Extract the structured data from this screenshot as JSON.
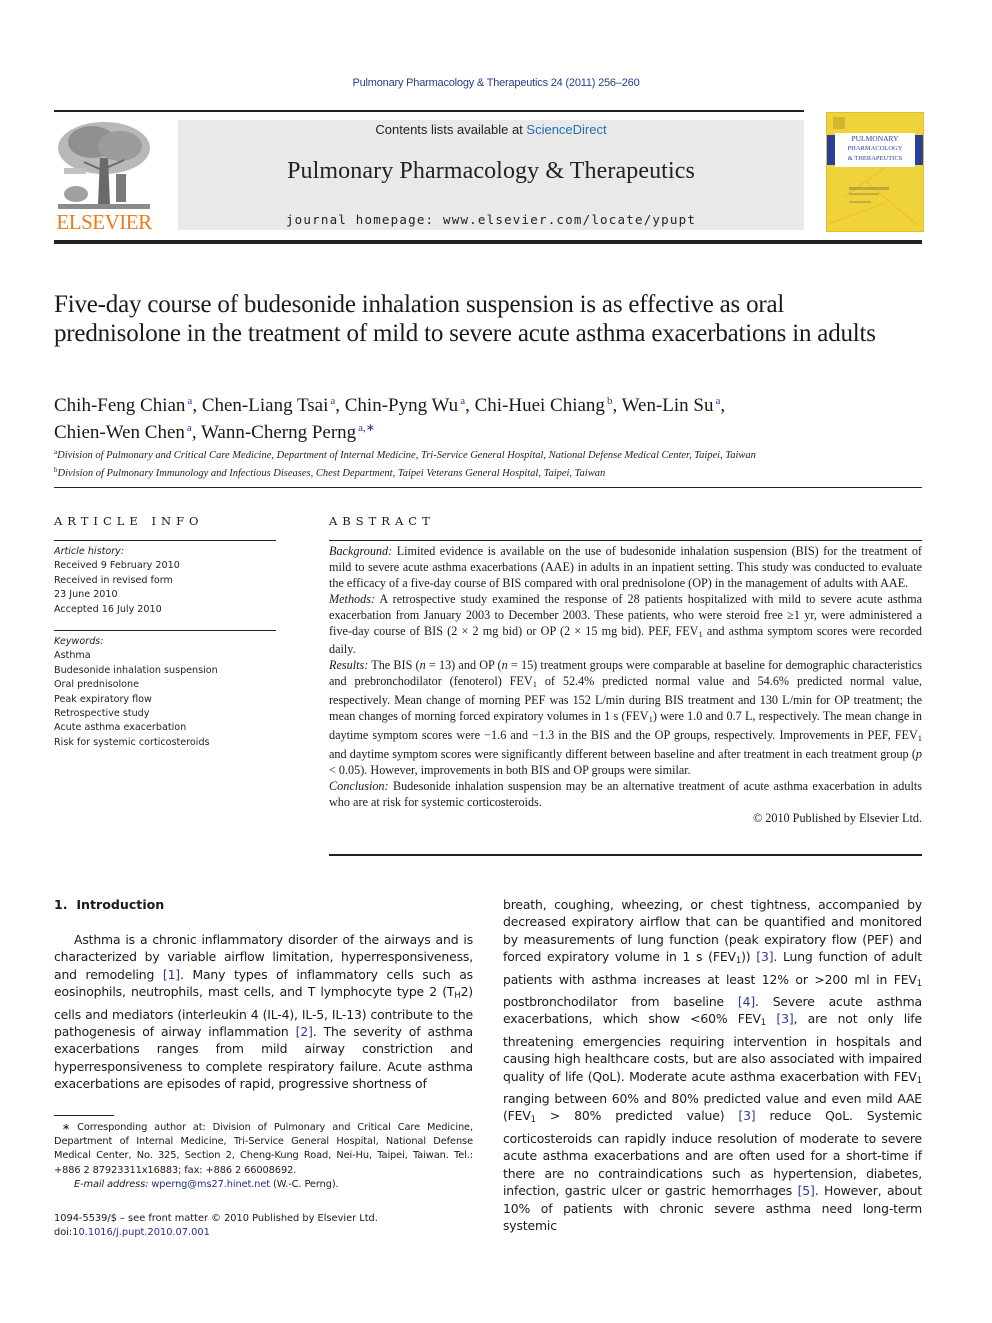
{
  "running_head": "Pulmonary Pharmacology & Therapeutics 24 (2011) 256–260",
  "publisher": {
    "logo_word": "ELSEVIER",
    "logo_icon": "elsevier-tree-icon"
  },
  "journal_box": {
    "contents_prefix": "Contents lists available at ",
    "contents_link": "ScienceDirect",
    "journal_title": "Pulmonary Pharmacology & Therapeutics",
    "homepage": "journal homepage: www.elsevier.com/locate/ypupt"
  },
  "cover": {
    "title_lines": [
      "PULMONARY",
      "PHARMACOLOGY",
      "& THERAPEUTICS"
    ],
    "colors": {
      "background": "#f0d23a",
      "band": "#2a3f99"
    }
  },
  "article": {
    "title": "Five-day course of budesonide inhalation suspension is as effective as oral prednisolone in the treatment of mild to severe acute asthma exacerbations in adults",
    "authors": [
      {
        "name": "Chih-Feng Chian",
        "aff": "a",
        "sep": ", "
      },
      {
        "name": "Chen-Liang Tsai",
        "aff": "a",
        "sep": ", "
      },
      {
        "name": "Chin-Pyng Wu",
        "aff": "a",
        "sep": ", "
      },
      {
        "name": "Chi-Huei Chiang",
        "aff": "b",
        "sep": ", "
      },
      {
        "name": "Wen-Lin Su",
        "aff": "a",
        "sep": ", "
      },
      {
        "name": "Chien-Wen Chen",
        "aff": "a",
        "sep": ", "
      },
      {
        "name": "Wann-Cherng Perng",
        "aff": "a,∗",
        "sep": ""
      }
    ],
    "affiliations": [
      {
        "key": "a",
        "text": "Division of Pulmonary and Critical Care Medicine, Department of Internal Medicine, Tri-Service General Hospital, National Defense Medical Center, Taipei, Taiwan"
      },
      {
        "key": "b",
        "text": "Division of Pulmonary Immunology and Infectious Diseases, Chest Department, Taipei Veterans General Hospital, Taipei, Taiwan"
      }
    ]
  },
  "article_info": {
    "heading": "ARTICLE INFO",
    "history_label": "Article history:",
    "history": [
      "Received 9 February 2010",
      "Received in revised form",
      "23 June 2010",
      "Accepted 16 July 2010"
    ],
    "keywords_label": "Keywords:",
    "keywords": [
      "Asthma",
      "Budesonide inhalation suspension",
      "Oral prednisolone",
      "Peak expiratory flow",
      "Retrospective study",
      "Acute asthma exacerbation",
      "Risk for systemic corticosteroids"
    ]
  },
  "abstract": {
    "heading": "ABSTRACT",
    "sections": [
      {
        "label": "Background:",
        "html": " Limited evidence is available on the use of budesonide inhalation suspension (BIS) for the treatment of mild to severe acute asthma exacerbations (AAE) in adults in an inpatient setting. This study was conducted to evaluate the efficacy of a five-day course of BIS compared with oral prednisolone (OP) in the management of adults with AAE."
      },
      {
        "label": "Methods:",
        "html": " A retrospective study examined the response of 28 patients hospitalized with mild to severe acute asthma exacerbation from January 2003 to December 2003. These patients, who were steroid free ≥1 yr, were administered a five-day course of BIS (2 × 2 mg bid) or OP (2 × 15 mg bid). PEF, FEV<sub>1</sub> and asthma symptom scores were recorded daily."
      },
      {
        "label": "Results:",
        "html": " The BIS (<i>n</i> = 13) and OP (<i>n</i> = 15) treatment groups were comparable at baseline for demographic characteristics and prebronchodilator (fenoterol) FEV<sub>1</sub> of 52.4% predicted normal value and 54.6% predicted normal value, respectively. Mean change of morning PEF was 152 L/min during BIS treatment and 130 L/min for OP treatment; the mean changes of morning forced expiratory volumes in 1 s (FEV<sub>1</sub>) were 1.0 and 0.7 L, respectively. The mean change in daytime symptom scores were −1.6 and −1.3 in the BIS and the OP groups, respectively. Improvements in PEF, FEV<sub>1</sub> and daytime symptom scores were significantly different between baseline and after treatment in each treatment group (<i>p</i> &lt; 0.05). However, improvements in both BIS and OP groups were similar."
      },
      {
        "label": "Conclusion:",
        "html": " Budesonide inhalation suspension may be an alternative treatment of acute asthma exacerbation in adults who are at risk for systemic corticosteroids."
      }
    ],
    "copyright": "© 2010 Published by Elsevier Ltd."
  },
  "introduction": {
    "heading": "1.  Introduction",
    "left_html": "Asthma is a chronic inflammatory disorder of the airways and is characterized by variable airflow limitation, hyperresponsiveness, and remodeling <span class=\"citation\">[1]</span>. Many types of inflammatory cells such as eosinophils, neutrophils, mast cells, and T lymphocyte type 2 (T<sub>H</sub>2) cells and mediators (interleukin 4 (IL-4), IL-5, IL-13) contribute to the pathogenesis of airway inflammation <span class=\"citation\">[2]</span>. The severity of asthma exacerbations ranges from mild airway constriction and hyperresponsiveness to complete respiratory failure. Acute asthma exacerbations are episodes of rapid, progressive shortness of",
    "right_html": "breath, coughing, wheezing, or chest tightness, accompanied by decreased expiratory airflow that can be quantified and monitored by measurements of lung function (peak expiratory flow (PEF) and forced expiratory volume in 1 s (FEV<sub>1</sub>)) <span class=\"citation\">[3]</span>. Lung function of adult patients with asthma increases at least 12% or &gt;200 ml in FEV<sub>1</sub> postbronchodilator from baseline <span class=\"citation\">[4]</span>. Severe acute asthma exacerbations, which show &lt;60% FEV<sub>1</sub> <span class=\"citation\">[3]</span>, are not only life threatening emergencies requiring intervention in hospitals and causing high healthcare costs, but are also associated with impaired quality of life (QoL). Moderate acute asthma exacerbation with FEV<sub>1</sub> ranging between 60% and 80% predicted value and even mild AAE (FEV<sub>1</sub> &gt; 80% predicted value) <span class=\"citation\">[3]</span> reduce QoL. Systemic corticosteroids can rapidly induce resolution of moderate to severe acute asthma exacerbations and are often used for a short-time if there are no contraindications such as hypertension, diabetes, infection, gastric ulcer or gastric hemorrhages <span class=\"citation\">[5]</span>. However, about 10% of patients with chronic severe asthma need long-term systemic"
  },
  "footnote": {
    "corresponding": "∗ Corresponding author at: Division of Pulmonary and Critical Care Medicine, Department of Internal Medicine, Tri-Service General Hospital, National Defense Medical Center, No. 325, Section 2, Cheng-Kung Road, Nei-Hu, Taipei, Taiwan. Tel.: +886 2 87923311x16883; fax: +886 2 66008692.",
    "email_label": "E-mail address:",
    "email": "wperng@ms27.hinet.net",
    "email_suffix": " (W.-C. Perng)."
  },
  "front_matter": {
    "issn_line": "1094-5539/$ – see front matter © 2010 Published by Elsevier Ltd.",
    "doi_prefix": "doi:",
    "doi": "10.1016/j.pupt.2010.07.001"
  }
}
